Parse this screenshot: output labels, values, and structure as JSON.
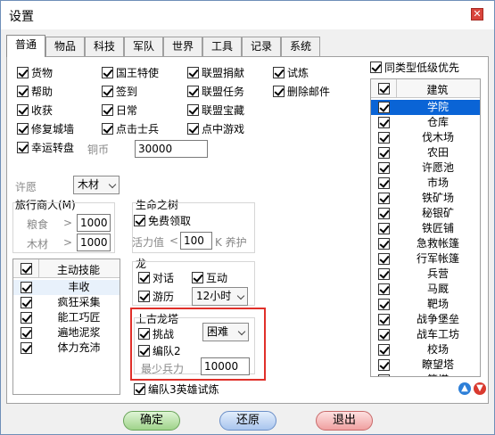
{
  "window": {
    "title": "设置",
    "close": "✕"
  },
  "tabs": [
    "普通",
    "物品",
    "科技",
    "军队",
    "世界",
    "工具",
    "记录",
    "系统"
  ],
  "options": [
    {
      "label": "货物",
      "checked": true
    },
    {
      "label": "国王特使",
      "checked": true
    },
    {
      "label": "联盟捐献",
      "checked": true
    },
    {
      "label": "试炼",
      "checked": true
    },
    {
      "label": "帮助",
      "checked": true
    },
    {
      "label": "签到",
      "checked": true
    },
    {
      "label": "联盟任务",
      "checked": true
    },
    {
      "label": "删除邮件",
      "checked": true
    },
    {
      "label": "收获",
      "checked": true
    },
    {
      "label": "日常",
      "checked": true
    },
    {
      "label": "联盟宝藏",
      "checked": true
    },
    {
      "label": "修复城墙",
      "checked": true
    },
    {
      "label": "点击士兵",
      "checked": true
    },
    {
      "label": "点中游戏",
      "checked": true
    },
    {
      "label": "幸运转盘",
      "checked": true
    }
  ],
  "copper": {
    "label": "铜币",
    "value": "30000"
  },
  "wish": {
    "label": "许愿",
    "value": "木材"
  },
  "merchant": {
    "title": "旅行商人(M)",
    "food_label": "粮食",
    "food_value": "1000",
    "wood_label": "木材",
    "wood_value": "1000",
    "gt": ">"
  },
  "life_tree": {
    "title": "生命之树",
    "free_label": "免费领取",
    "energy_label": "活力值",
    "lt": "<",
    "energy_value": "100",
    "suffix": "K 养护"
  },
  "skills": {
    "header": "主动技能",
    "items": [
      "丰收",
      "疯狂采集",
      "能工巧匠",
      "遍地泥浆",
      "体力充沛"
    ]
  },
  "dragon": {
    "title": "龙",
    "talk": "对话",
    "interact": "互动",
    "tour": "游历",
    "tour_time": "12小时"
  },
  "ancient_dragon": {
    "title": "上古龙塔",
    "challenge": "挑战",
    "difficulty": "困难",
    "team": "编队2",
    "min_troops_label": "最少兵力",
    "min_troops": "10000"
  },
  "hero_trial": "编队3英雄试炼",
  "same_type_low": "同类型低级优先",
  "buildings": {
    "header": "建筑",
    "items": [
      "学院",
      "仓库",
      "伐木场",
      "农田",
      "许愿池",
      "市场",
      "铁矿场",
      "秘银矿",
      "铁匠铺",
      "急救帐篷",
      "行军帐篷",
      "兵营",
      "马厩",
      "靶场",
      "战争堡垒",
      "战车工坊",
      "校场",
      "瞭望塔",
      "箭塔"
    ]
  },
  "buttons": {
    "ok": "确定",
    "restore": "还原",
    "exit": "退出"
  },
  "colors": {
    "ok": "#9fd38a",
    "restore": "#a9c5ee",
    "exit": "#f0a0a0",
    "selected_row": "#0a64d6"
  }
}
